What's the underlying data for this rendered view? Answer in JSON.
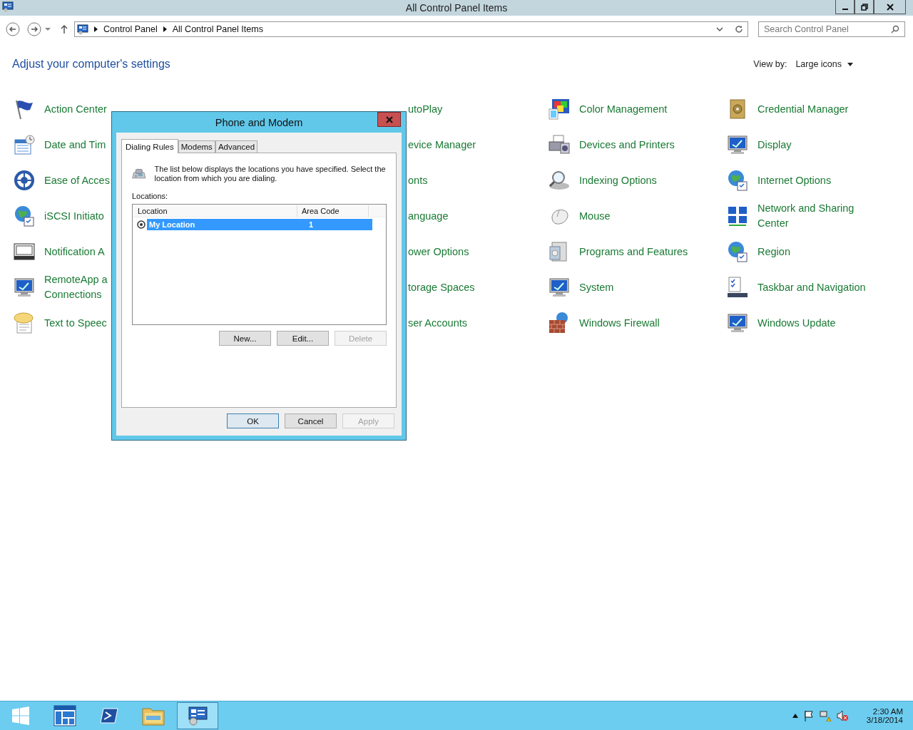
{
  "window": {
    "title": "All Control Panel Items"
  },
  "address_bar": {
    "breadcrumbs": [
      "Control Panel",
      "All Control Panel Items"
    ]
  },
  "search": {
    "placeholder": "Search Control Panel"
  },
  "heading": "Adjust your computer's settings",
  "view_by": {
    "label": "View by:",
    "value": "Large icons"
  },
  "columns": [
    {
      "items": [
        {
          "label": "Action Center"
        },
        {
          "label": "Date and Tim"
        },
        {
          "label": "Ease of Acces"
        },
        {
          "label": "iSCSI Initiato"
        },
        {
          "label": "Notification A"
        },
        {
          "label": "RemoteApp a\nConnections"
        },
        {
          "label": "Text to Speec"
        }
      ]
    },
    {
      "items": [
        {
          "label": "utoPlay"
        },
        {
          "label": "evice Manager"
        },
        {
          "label": "onts"
        },
        {
          "label": "anguage"
        },
        {
          "label": "ower Options"
        },
        {
          "label": "torage Spaces"
        },
        {
          "label": "ser Accounts"
        }
      ]
    },
    {
      "items": [
        {
          "label": "Color Management"
        },
        {
          "label": "Devices and Printers"
        },
        {
          "label": "Indexing Options"
        },
        {
          "label": "Mouse"
        },
        {
          "label": "Programs and Features"
        },
        {
          "label": "System"
        },
        {
          "label": "Windows Firewall"
        }
      ]
    },
    {
      "items": [
        {
          "label": "Credential Manager"
        },
        {
          "label": "Display"
        },
        {
          "label": "Internet Options"
        },
        {
          "label": "Network and Sharing Center"
        },
        {
          "label": "Region"
        },
        {
          "label": "Taskbar and Navigation"
        },
        {
          "label": "Windows Update"
        }
      ]
    }
  ],
  "dialog": {
    "title": "Phone and Modem",
    "tabs": [
      {
        "label": "Dialing Rules",
        "selected": true
      },
      {
        "label": "Modems",
        "selected": false
      },
      {
        "label": "Advanced",
        "selected": false
      }
    ],
    "description": "The list below displays the locations you have specified. Select the location from which you are dialing.",
    "locations_label": "Locations:",
    "list_columns": [
      "Location",
      "Area Code"
    ],
    "rows": [
      {
        "location": "My Location",
        "area_code": "1",
        "selected": true
      }
    ],
    "buttons": [
      {
        "label": "New...",
        "disabled": false
      },
      {
        "label": "Edit...",
        "disabled": false
      },
      {
        "label": "Delete",
        "disabled": true
      }
    ],
    "footer_buttons": [
      {
        "label": "OK",
        "disabled": false,
        "default": true
      },
      {
        "label": "Cancel",
        "disabled": false,
        "default": false
      },
      {
        "label": "Apply",
        "disabled": true,
        "default": false
      }
    ]
  },
  "taskbar": {
    "items": [
      {
        "selected": false
      },
      {
        "selected": false
      },
      {
        "selected": false
      },
      {
        "selected": false
      },
      {
        "selected": true
      }
    ],
    "clock": {
      "time": "2:30 AM",
      "date": "3/18/2014"
    }
  }
}
